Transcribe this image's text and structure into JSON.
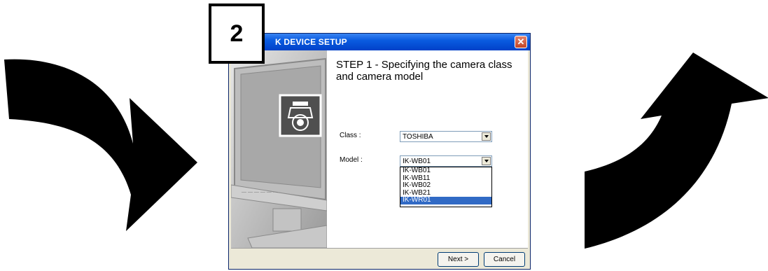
{
  "step_badge": "2",
  "window": {
    "title": "K DEVICE SETUP",
    "close_glyph": "✕",
    "step_title": "STEP 1 -  Specifying the camera class and camera model",
    "class_label": "Class :",
    "class_value": "TOSHIBA",
    "model_label": "Model :",
    "model_value": "IK-WB01",
    "model_options": [
      "IK-WB01",
      "IK-WB11",
      "IK-WB02",
      "IK-WB21",
      "IK-WR01"
    ],
    "model_highlighted": "IK-WR01",
    "next_label": "Next >",
    "cancel_label": "Cancel"
  },
  "icons": {
    "left_arrow": "curved-arrow-down-right-icon",
    "right_arrow": "curved-arrow-up-right-icon",
    "camera": "ptz-camera-icon"
  },
  "colors": {
    "titlebar": "#0a5be0",
    "selection": "#316ac5",
    "close": "#c34426"
  }
}
